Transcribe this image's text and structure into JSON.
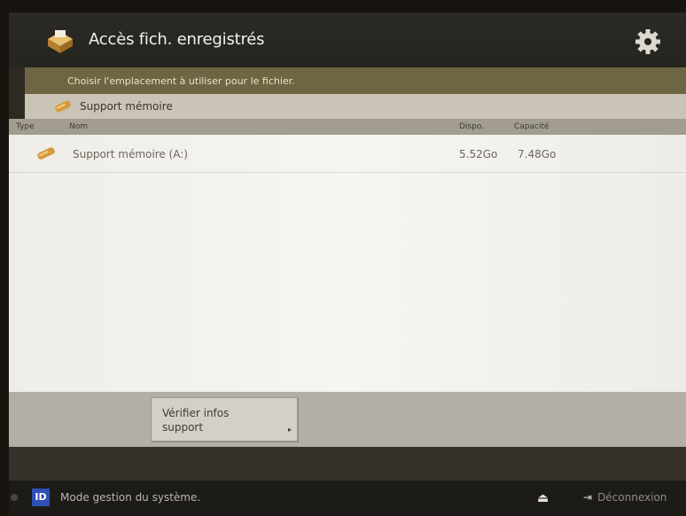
{
  "header": {
    "title": "Accès fich. enregistrés",
    "icon": "file-drawer-icon",
    "settings_icon": "gear-icon"
  },
  "instruction": "Choisir l'emplacement à utiliser pour le fichier.",
  "location": {
    "icon": "memory-media-icon",
    "label": "Support mémoire"
  },
  "columns": {
    "type": "Type",
    "name": "Nom",
    "free": "Dispo.",
    "capacity": "Capacité"
  },
  "rows": [
    {
      "icon": "memory-media-icon",
      "name": "Support mémoire (A:)",
      "free": "5.52Go",
      "capacity": "7.48Go"
    }
  ],
  "toolbar": {
    "check_button": "Vérifier infos support",
    "arrow": "▸"
  },
  "status": {
    "id_badge": "ID",
    "mode": "Mode gestion du système.",
    "eject_icon": "eject-icon",
    "logout_label": "Déconnexion"
  },
  "colors": {
    "instruction_bar": "#6d6543",
    "location_bar": "#c9c4b6",
    "id_badge": "#2f4fb5",
    "media_icon": "#d69a3c"
  }
}
